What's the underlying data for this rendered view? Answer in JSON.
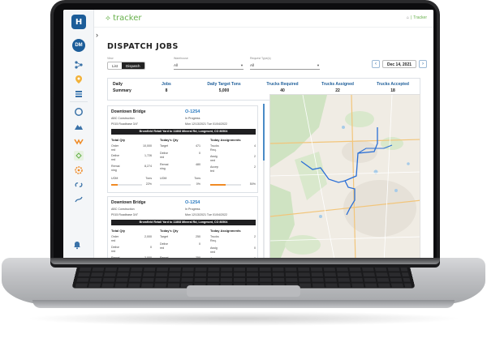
{
  "app": {
    "brand": "tracker",
    "logo_letter": "H",
    "avatar_initials": "DM"
  },
  "breadcrumb": {
    "home_icon": "home-icon",
    "current": "Tracker"
  },
  "page": {
    "title": "DISPATCH JOBS"
  },
  "controls": {
    "view_label": "View",
    "view_options": [
      "List",
      "Dispatch"
    ],
    "view_selected": "Dispatch",
    "select1_label": "Warehouse",
    "select1_value": "All",
    "select2_label": "Request Type(s)",
    "select2_value": "All",
    "date": "Dec 14, 2021",
    "prev_icon": "chevron-left-icon",
    "next_icon": "chevron-right-icon"
  },
  "summary": {
    "title_line1": "Daily",
    "title_line2": "Summary",
    "items": [
      {
        "label": "Jobs",
        "value": "8"
      },
      {
        "label": "Daily Target Tons",
        "value": "5,000"
      },
      {
        "label": "Trucks Required",
        "value": "40"
      },
      {
        "label": "Trucks Assigned",
        "value": "22"
      },
      {
        "label": "Trucks Accepted",
        "value": "18"
      }
    ]
  },
  "jobs": [
    {
      "name": "Downtown Bridge",
      "id": "O-1254",
      "client": "ABC Construction",
      "status": "In Progress",
      "product": "P015 Roadbase 3/4\"",
      "time": "Mon 12/13/2021 Tue 01/04/2022",
      "route": "Bromfield Retail Yard to 11868 Mineral Rd, Longmont, CO 80504",
      "total_qty_head": "Total Qty",
      "todays_qty_head": "Today's Qty",
      "assign_head": "Today Assignments",
      "total_rows": [
        {
          "k": "Order",
          "v": "10,000"
        },
        {
          "k": "red",
          "v": ""
        },
        {
          "k": "Delive",
          "v": "1,726"
        },
        {
          "k": "red",
          "v": ""
        },
        {
          "k": "Remai",
          "v": "8,274"
        },
        {
          "k": "ning",
          "v": ""
        },
        {
          "k": "UOM",
          "v": "Tons"
        }
      ],
      "today_rows": [
        {
          "k": "Target",
          "v": "471"
        },
        {
          "k": "Delive",
          "v": "0"
        },
        {
          "k": "red",
          "v": ""
        },
        {
          "k": "Remai",
          "v": "480"
        },
        {
          "k": "ning",
          "v": ""
        },
        {
          "k": "UOM",
          "v": "Tons"
        }
      ],
      "assign_rows": [
        {
          "k": "Trucks",
          "v": "4"
        },
        {
          "k": "Req.",
          "v": ""
        },
        {
          "k": "Assig",
          "v": "2"
        },
        {
          "k": "ned",
          "v": ""
        },
        {
          "k": "Accep",
          "v": "2"
        },
        {
          "k": "ted",
          "v": ""
        }
      ],
      "pct_total": "22%",
      "pct_today": "0%",
      "pct_assign": "50%",
      "fill_total": 0.22,
      "fill_today": 0.0,
      "fill_assign": 0.5
    },
    {
      "name": "Downtown Bridge",
      "id": "O-1254",
      "client": "ABC Construction",
      "status": "In Progress",
      "product": "P015 Roadbase 3/4\"",
      "time": "Mon 12/13/2021 Tue 01/04/2022",
      "route": "Bromfield Retail Yard to 11868 Mineral Rd, Longmont, CO 80504",
      "total_qty_head": "Total Qty",
      "todays_qty_head": "Today's Qty",
      "assign_head": "Today Assignments",
      "total_rows": [
        {
          "k": "Order",
          "v": "2,000"
        },
        {
          "k": "red",
          "v": ""
        },
        {
          "k": "Delive",
          "v": "0"
        },
        {
          "k": "red",
          "v": ""
        },
        {
          "k": "Remai",
          "v": "2,000"
        }
      ],
      "today_rows": [
        {
          "k": "Target",
          "v": "250"
        },
        {
          "k": "Delive",
          "v": "0"
        },
        {
          "k": "red",
          "v": ""
        },
        {
          "k": "Remai",
          "v": "250"
        }
      ],
      "assign_rows": [
        {
          "k": "Trucks",
          "v": "2"
        },
        {
          "k": "Req.",
          "v": ""
        },
        {
          "k": "Assig",
          "v": "0"
        },
        {
          "k": "ned",
          "v": ""
        },
        {
          "k": "Accep",
          "v": "0"
        }
      ]
    }
  ],
  "colors": {
    "accent": "#1c5d99",
    "brand_green": "#66b04a",
    "progress": "#f08a24",
    "route": "#2a6fd6"
  },
  "sidebar_icons": [
    "org-chart-icon",
    "location-pin-icon",
    "stack-icon",
    "ring-icon",
    "mountain-icon",
    "wave-icon",
    "tracker-icon",
    "gear-icon",
    "link-icon",
    "chain-icon",
    "bell-icon"
  ]
}
